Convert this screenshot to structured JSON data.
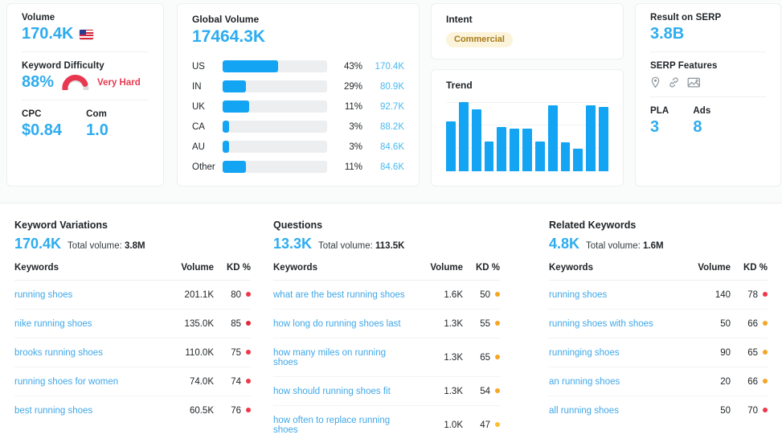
{
  "overview": {
    "volume": {
      "label": "Volume",
      "value": "170.4K",
      "flag": "us-flag-icon"
    },
    "keyword_difficulty": {
      "label": "Keyword Difficulty",
      "value": "88%",
      "rating": "Very Hard",
      "percent": 88,
      "gauge_color": "#e8384f",
      "track_color": "#d9dde0"
    },
    "cpc": {
      "label": "CPC",
      "value": "$0.84"
    },
    "com": {
      "label": "Com",
      "value": "1.0"
    }
  },
  "global_volume": {
    "title": "Global Volume",
    "total": "17464.3K",
    "rows": [
      {
        "country": "US",
        "percent": "43%",
        "fill": 53,
        "volume": "170.4K"
      },
      {
        "country": "IN",
        "percent": "29%",
        "fill": 22,
        "volume": "80.9K"
      },
      {
        "country": "UK",
        "percent": "11%",
        "fill": 25,
        "volume": "92.7K"
      },
      {
        "country": "CA",
        "percent": "3%",
        "fill": 6,
        "volume": "88.2K"
      },
      {
        "country": "AU",
        "percent": "3%",
        "fill": 6,
        "volume": "84.6K"
      },
      {
        "country": "Other",
        "percent": "11%",
        "fill": 22,
        "volume": "84.6K"
      }
    ]
  },
  "intent": {
    "title": "Intent",
    "badge": "Commercial",
    "badge_bg": "#fcf3db",
    "badge_color": "#a67c18"
  },
  "trend": {
    "title": "Trend",
    "chart_data": {
      "type": "bar",
      "title": "Trend",
      "xlabel": "",
      "ylabel": "",
      "categories": [
        "1",
        "2",
        "3",
        "4",
        "5",
        "6",
        "7",
        "8",
        "9",
        "10",
        "11",
        "12",
        "13"
      ],
      "values": [
        56,
        78,
        70,
        34,
        50,
        48,
        48,
        34,
        74,
        33,
        25,
        74,
        73
      ],
      "ylim": [
        0,
        100
      ],
      "grid": true,
      "series_color": "#13a4f4"
    }
  },
  "serp": {
    "result_label": "Result on SERP",
    "result_value": "3.8B",
    "features_label": "SERP Features",
    "features": [
      "location-pin-icon",
      "link-icon",
      "image-icon"
    ],
    "pla_label": "PLA",
    "pla_value": "3",
    "ads_label": "Ads",
    "ads_value": "8"
  },
  "tables": {
    "columns": {
      "keywords": "Keywords",
      "volume": "Volume",
      "kd": "KD %"
    },
    "variations": {
      "title": "Keyword Variations",
      "count": "170.4K",
      "total_label": "Total volume:",
      "total_value": "3.8M",
      "rows": [
        {
          "keyword": "running shoes",
          "volume": "201.1K",
          "kd": "80",
          "dot": "#f0374a"
        },
        {
          "keyword": "nike running shoes",
          "volume": "135.0K",
          "kd": "85",
          "dot": "#e02a3c"
        },
        {
          "keyword": "brooks running shoes",
          "volume": "110.0K",
          "kd": "75",
          "dot": "#f0374a"
        },
        {
          "keyword": "running shoes for women",
          "volume": "74.0K",
          "kd": "74",
          "dot": "#f0374a"
        },
        {
          "keyword": "best running shoes",
          "volume": "60.5K",
          "kd": "76",
          "dot": "#f0374a"
        }
      ]
    },
    "questions": {
      "title": "Questions",
      "count": "13.3K",
      "total_label": "Total volume:",
      "total_value": "113.5K",
      "rows": [
        {
          "keyword": "what are the best running shoes",
          "volume": "1.6K",
          "kd": "50",
          "dot": "#f5a623"
        },
        {
          "keyword": "how long do running shoes last",
          "volume": "1.3K",
          "kd": "55",
          "dot": "#f5a623"
        },
        {
          "keyword": "how many miles on running shoes",
          "volume": "1.3K",
          "kd": "65",
          "dot": "#f5a623"
        },
        {
          "keyword": "how should running shoes fit",
          "volume": "1.3K",
          "kd": "54",
          "dot": "#f5a623"
        },
        {
          "keyword": "how often to replace running shoes",
          "volume": "1.0K",
          "kd": "47",
          "dot": "#fbc02d"
        }
      ]
    },
    "related": {
      "title": "Related Keywords",
      "count": "4.8K",
      "total_label": "Total volume:",
      "total_value": "1.6M",
      "rows": [
        {
          "keyword": "running shoes",
          "volume": "140",
          "kd": "78",
          "dot": "#f0374a"
        },
        {
          "keyword": "running shoes with shoes",
          "volume": "50",
          "kd": "66",
          "dot": "#f5a623"
        },
        {
          "keyword": "runninging shoes",
          "volume": "90",
          "kd": "65",
          "dot": "#f5a623"
        },
        {
          "keyword": "an running shoes",
          "volume": "20",
          "kd": "66",
          "dot": "#f5a623"
        },
        {
          "keyword": "all running shoes",
          "volume": "50",
          "kd": "70",
          "dot": "#f0374a"
        }
      ]
    }
  }
}
